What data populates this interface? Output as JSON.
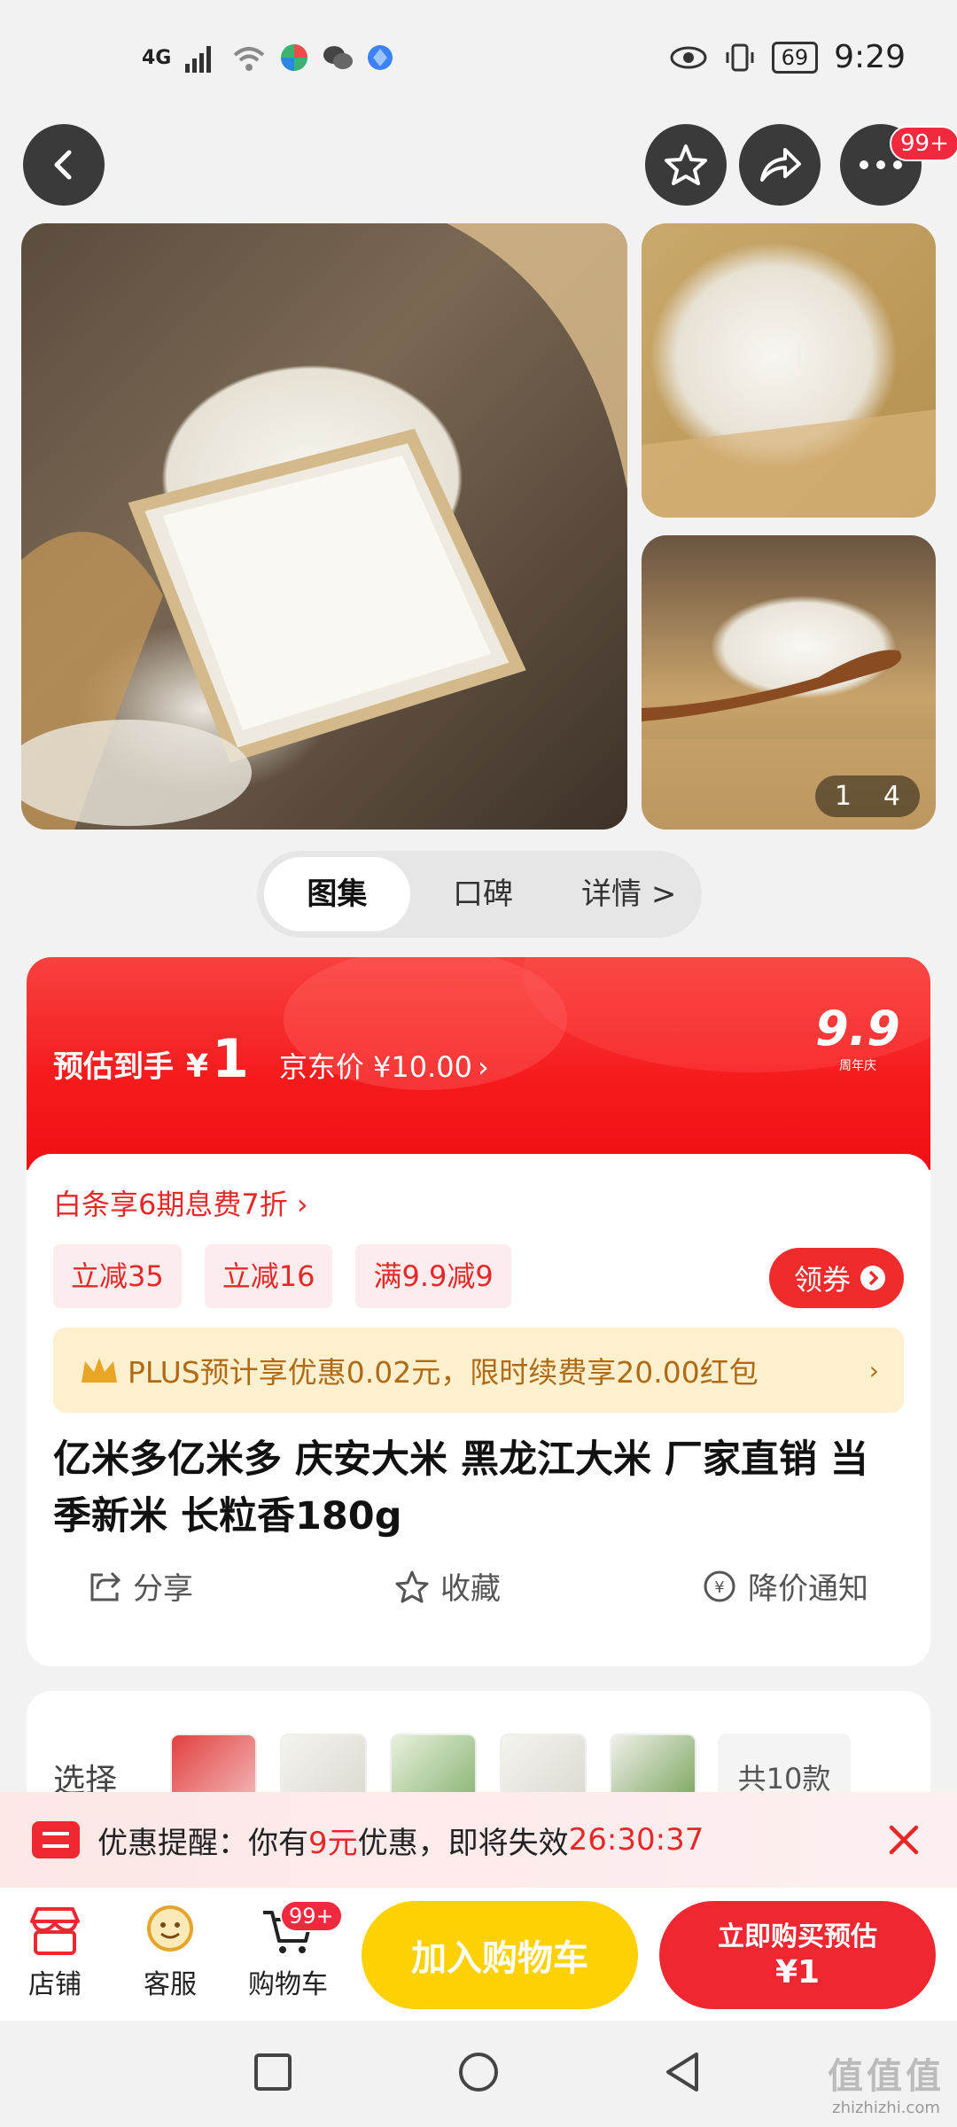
{
  "status": {
    "network": "4G",
    "battery": "69",
    "time": "9:29"
  },
  "topbar": {
    "more_badge": "99+"
  },
  "gallery": {
    "counter_current": "1",
    "counter_total": "4"
  },
  "tabs": [
    {
      "label": "图集"
    },
    {
      "label": "口碑"
    },
    {
      "label": "详情 >"
    }
  ],
  "price": {
    "est_label": "预估到手",
    "currency": "¥",
    "est_value": "1",
    "jd_price": "京东价 ¥10.00",
    "jd_arrow": "›",
    "promo_logo": "9.9",
    "promo_logo_sub": "周年庆"
  },
  "baitiao": "白条享6期息费7折 ›",
  "chips": [
    "立减35",
    "立减16",
    "满9.9减9"
  ],
  "coupon_button": "领券",
  "plus_text": "PLUS预计享优惠0.02元，限时续费享20.00红包",
  "plus_arrow": "›",
  "product_title": "亿米多亿米多 庆安大米  黑龙江大米 厂家直销 当季新米 长粒香180g",
  "actions": [
    {
      "label": "分享"
    },
    {
      "label": "收藏"
    },
    {
      "label": "降价通知"
    }
  ],
  "select": {
    "label": "选择",
    "count": "共10款"
  },
  "notice": {
    "prefix": "优惠提醒：你有",
    "amount": "9元",
    "suffix": "优惠，即将失效",
    "countdown": "26:30:37"
  },
  "bottom_nav": {
    "store": "店铺",
    "service": "客服",
    "cart": "购物车",
    "cart_badge": "99+",
    "add_cart": "加入购物车",
    "buy_now_line1": "立即购买预估",
    "buy_now_line2": "¥1"
  },
  "watermark": "zhizhizhi.com",
  "colors": {
    "brand_red": "#f5191b",
    "cart_yellow": "#fdd103",
    "buy_red": "#ee2731"
  }
}
